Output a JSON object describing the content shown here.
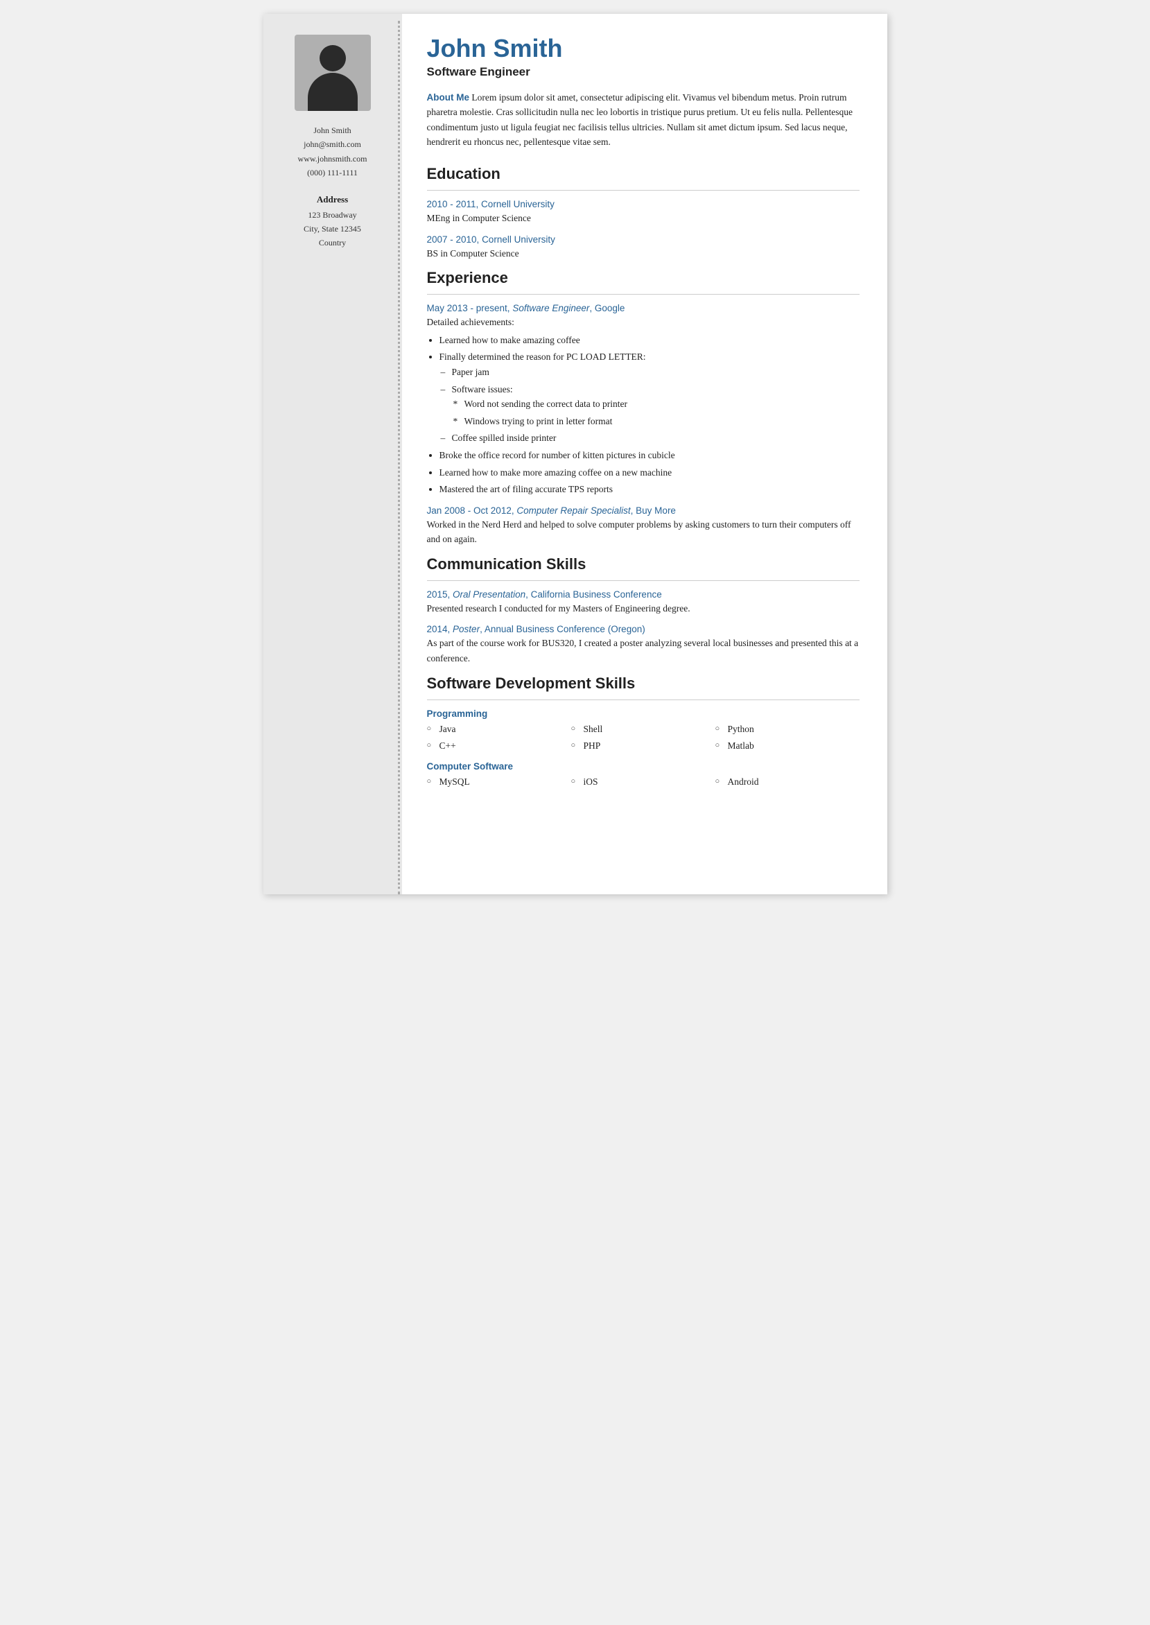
{
  "sidebar": {
    "name": "John Smith",
    "email": "john@smith.com",
    "website": "www.johnsmith.com",
    "phone": "(000) 111-1111",
    "address_label": "Address",
    "address_line1": "123 Broadway",
    "address_line2": "City, State 12345",
    "address_line3": "Country"
  },
  "header": {
    "name": "John Smith",
    "job_title": "Software Engineer"
  },
  "about_me": {
    "label": "About Me",
    "text": " Lorem ipsum dolor sit amet, consectetur adipiscing elit. Vivamus vel bibendum metus. Proin rutrum pharetra molestie. Cras sollicitudin nulla nec leo lobortis in tristique purus pretium. Ut eu felis nulla. Pellentesque condimentum justo ut ligula feugiat nec facilisis tellus ultricies. Nullam sit amet dictum ipsum. Sed lacus neque, hendrerit eu rhoncus nec, pellentesque vitae sem."
  },
  "education": {
    "heading": "Education",
    "entries": [
      {
        "title": "2010 - 2011, Cornell University",
        "degree": "MEng in Computer Science"
      },
      {
        "title": "2007 - 2010, Cornell University",
        "degree": "BS in Computer Science"
      }
    ]
  },
  "experience": {
    "heading": "Experience",
    "entries": [
      {
        "title": "May 2013 - present, ",
        "title_italic": "Software Engineer",
        "title_end": ", Google",
        "achievements_label": "Detailed achievements:",
        "bullets": [
          "Learned how to make amazing coffee",
          "Finally determined the reason for PC LOAD LETTER:"
        ],
        "sub_bullets": [
          "Paper jam",
          "Software issues:"
        ],
        "sub_sub_bullets": [
          "Word not sending the correct data to printer",
          "Windows trying to print in letter format"
        ],
        "sub_bullets2": [
          "Coffee spilled inside printer"
        ],
        "more_bullets": [
          "Broke the office record for number of kitten pictures in cubicle",
          "Learned how to make more amazing coffee on a new machine",
          "Mastered the art of filing accurate TPS reports"
        ]
      },
      {
        "title": "Jan 2008 - Oct 2012, ",
        "title_italic": "Computer Repair Specialist",
        "title_end": ", Buy More",
        "body": "Worked in the Nerd Herd and helped to solve computer problems by asking customers to turn their computers off and on again."
      }
    ]
  },
  "communication": {
    "heading": "Communication Skills",
    "entries": [
      {
        "title": "2015, ",
        "title_italic": "Oral Presentation",
        "title_end": ", California Business Conference",
        "body": "Presented research I conducted for my Masters of Engineering degree."
      },
      {
        "title": "2014, ",
        "title_italic": "Poster",
        "title_end": ", Annual Business Conference (Oregon)",
        "body": "As part of the course work for BUS320, I created a poster analyzing several local businesses and presented this at a conference."
      }
    ]
  },
  "skills": {
    "heading": "Software Development Skills",
    "categories": [
      {
        "title": "Programming",
        "cols": [
          [
            "Java",
            "C++"
          ],
          [
            "Shell",
            "PHP"
          ],
          [
            "Python",
            "Matlab"
          ]
        ]
      },
      {
        "title": "Computer Software",
        "cols": [
          [
            "MySQL"
          ],
          [
            "iOS"
          ],
          [
            "Android"
          ]
        ]
      }
    ]
  }
}
